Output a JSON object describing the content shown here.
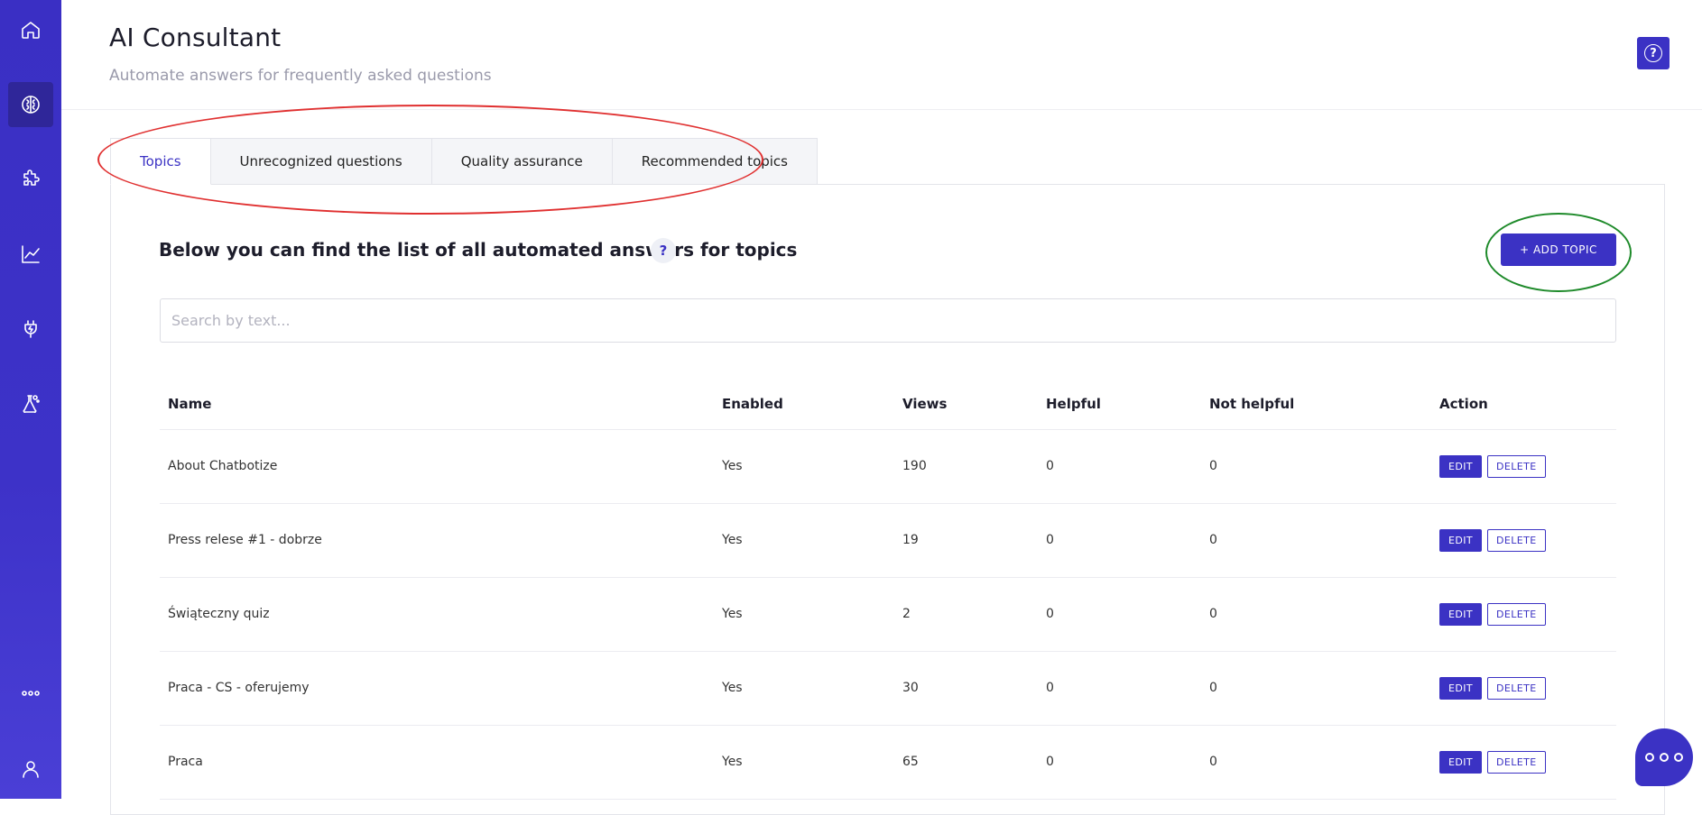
{
  "header": {
    "title": "AI Consultant",
    "subtitle": "Automate answers for frequently asked questions"
  },
  "sidebar": {
    "items": [
      {
        "icon": "home-icon"
      },
      {
        "icon": "brain-icon",
        "active": true
      },
      {
        "icon": "puzzle-icon"
      },
      {
        "icon": "chart-icon"
      },
      {
        "icon": "plug-icon"
      },
      {
        "icon": "flask-icon"
      },
      {
        "icon": "more-icon"
      },
      {
        "icon": "user-icon"
      }
    ]
  },
  "tabs": [
    {
      "label": "Topics",
      "active": true
    },
    {
      "label": "Unrecognized questions"
    },
    {
      "label": "Quality assurance"
    },
    {
      "label": "Recommended topics"
    }
  ],
  "panel": {
    "heading": "Below you can find the list of all automated answers for topics",
    "info": "?",
    "add_button": "+ ADD TOPIC",
    "search_placeholder": "Search by text..."
  },
  "table": {
    "columns": [
      "Name",
      "Enabled",
      "Views",
      "Helpful",
      "Not helpful",
      "Action"
    ],
    "edit_label": "EDIT",
    "delete_label": "DELETE",
    "rows": [
      {
        "name": "About Chatbotize",
        "enabled": "Yes",
        "views": "190",
        "helpful": "0",
        "not_helpful": "0"
      },
      {
        "name": "Press relese #1 - dobrze",
        "enabled": "Yes",
        "views": "19",
        "helpful": "0",
        "not_helpful": "0"
      },
      {
        "name": "Świąteczny quiz",
        "enabled": "Yes",
        "views": "2",
        "helpful": "0",
        "not_helpful": "0"
      },
      {
        "name": "Praca - CS - oferujemy",
        "enabled": "Yes",
        "views": "30",
        "helpful": "0",
        "not_helpful": "0"
      },
      {
        "name": "Praca",
        "enabled": "Yes",
        "views": "65",
        "helpful": "0",
        "not_helpful": "0"
      }
    ]
  },
  "colors": {
    "accent": "#3b32c4",
    "annotation_red": "#e03030",
    "annotation_green": "#1e8a2a"
  }
}
